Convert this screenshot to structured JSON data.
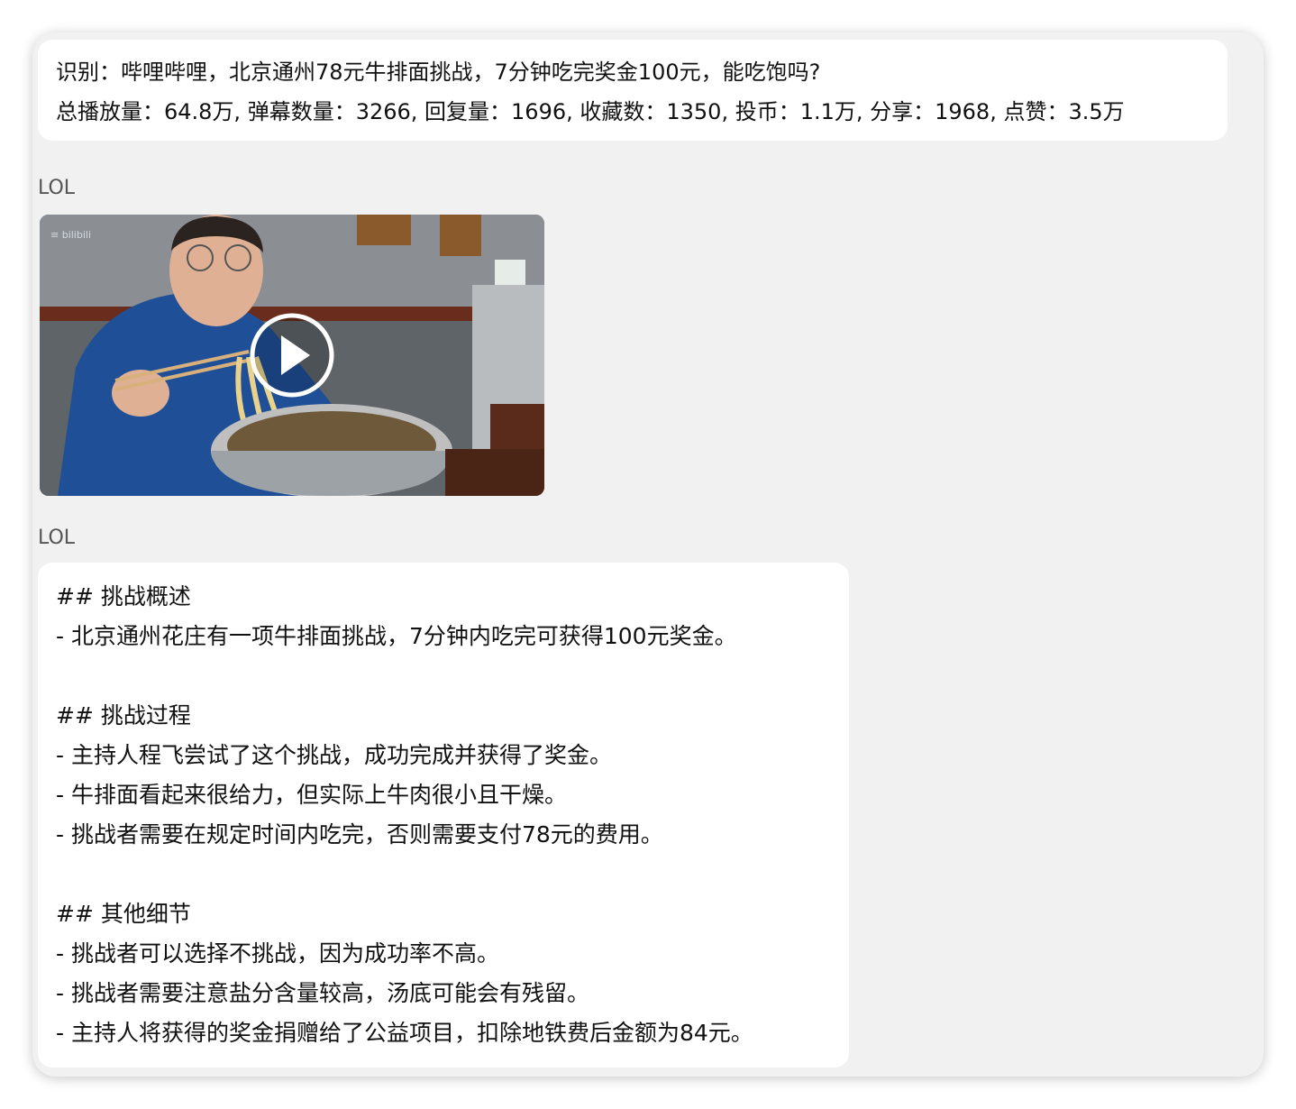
{
  "prompt": {
    "line1": "识别：哔哩哔哩，北京通州78元牛排面挑战，7分钟吃完奖金100元，能吃饱吗?",
    "line2": "总播放量：64.8万, 弹幕数量：3266, 回复量：1696, 收藏数：1350, 投币：1.1万, 分享：1968, 点赞：3.5万"
  },
  "messages": [
    {
      "sender": "LOL"
    },
    {
      "sender": "LOL"
    }
  ],
  "video": {
    "play_icon": "play-circle-icon",
    "logo_icon": "bilibili-watermark-icon"
  },
  "answer": {
    "lines": [
      "## 挑战概述",
      "- 北京通州花庄有一项牛排面挑战，7分钟内吃完可获得100元奖金。",
      "",
      "## 挑战过程",
      "- 主持人程飞尝试了这个挑战，成功完成并获得了奖金。",
      "- 牛排面看起来很给力，但实际上牛肉很小且干燥。",
      "- 挑战者需要在规定时间内吃完，否则需要支付78元的费用。",
      "",
      "## 其他细节",
      "- 挑战者可以选择不挑战，因为成功率不高。",
      "- 挑战者需要注意盐分含量较高，汤底可能会有残留。",
      "- 主持人将获得的奖金捐赠给了公益项目，扣除地铁费后金额为84元。"
    ]
  },
  "colors": {
    "window_bg": "#f1f1f1",
    "bubble_bg": "#ffffff",
    "sender_text": "#555555"
  }
}
